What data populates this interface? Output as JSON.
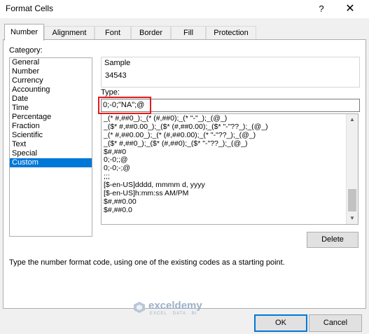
{
  "window": {
    "title": "Format Cells",
    "help": "?",
    "close": "✕"
  },
  "tabs": [
    "Number",
    "Alignment",
    "Font",
    "Border",
    "Fill",
    "Protection"
  ],
  "category": {
    "label": "Category:",
    "items": [
      "General",
      "Number",
      "Currency",
      "Accounting",
      "Date",
      "Time",
      "Percentage",
      "Fraction",
      "Scientific",
      "Text",
      "Special",
      "Custom"
    ],
    "selected": "Custom"
  },
  "sample": {
    "label": "Sample",
    "value": "34543"
  },
  "type": {
    "label": "Type:",
    "value": "0;-0;\"NA\";@"
  },
  "formats": [
    "_(* #,##0_);_(* (#,##0);_(* \"-\"_);_(@_)",
    "_($* #,##0.00_);_($* (#,##0.00);_($* \"-\"??_);_(@_)",
    "_(* #,##0.00_);_(* (#,##0.00);_(* \"-\"??_);_(@_)",
    "_($* #,##0_);_($* (#,##0);_($* \"-\"??_);_(@_)",
    "$#,##0",
    "0;-0;;@",
    "0;-0;-;@",
    ";;;",
    "[$-en-US]dddd, mmmm d, yyyy",
    "[$-en-US]h:mm:ss AM/PM",
    "$#,##0.00",
    "$#,##0.0"
  ],
  "buttons": {
    "delete": "Delete",
    "ok": "OK",
    "cancel": "Cancel"
  },
  "hint": "Type the number format code, using one of the existing codes as a starting point.",
  "watermark": {
    "name": "exceldemy",
    "tagline": "EXCEL · DATA · BI"
  },
  "colors": {
    "selection": "#0078d7",
    "highlight": "#e41a1c"
  }
}
